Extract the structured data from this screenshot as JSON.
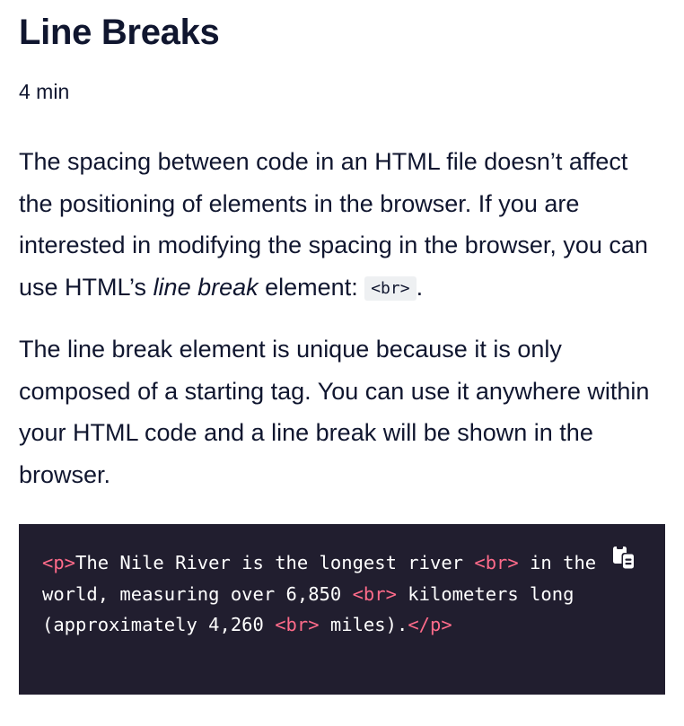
{
  "lesson": {
    "title": "Line Breaks",
    "duration": "4 min"
  },
  "paragraph1": {
    "part1": "The spacing between code in an HTML file doesn’t affect the positioning of elements in the browser. If you are interested in modifying the spacing in the browser, you can use HTML’s ",
    "emphasis": "line break",
    "part2": " element: ",
    "code": "<br>",
    "end": "."
  },
  "paragraph2": {
    "text": "The line break element is unique because it is only composed of a starting tag. You can use it anywhere within your HTML code and a line break will be shown in the browser."
  },
  "code_block": {
    "line1": {
      "open_tag": "<p>",
      "text1": "The Nile River is the longest river ",
      "br": "<br>",
      "text2": " in the"
    },
    "line2": {
      "text1": "world, measuring over 6,850 ",
      "br": "<br>",
      "text2": " kilometers long"
    },
    "line3": {
      "text1": "(approximately 4,260 ",
      "br": "<br>",
      "text2": " miles).",
      "close_tag": "</p>"
    },
    "copy_icon": "copy-icon"
  },
  "colors": {
    "heading": "#10162f",
    "code_background": "#211e2f",
    "code_tag": "#ff6b8a",
    "inline_code_background": "#eef0f2"
  }
}
